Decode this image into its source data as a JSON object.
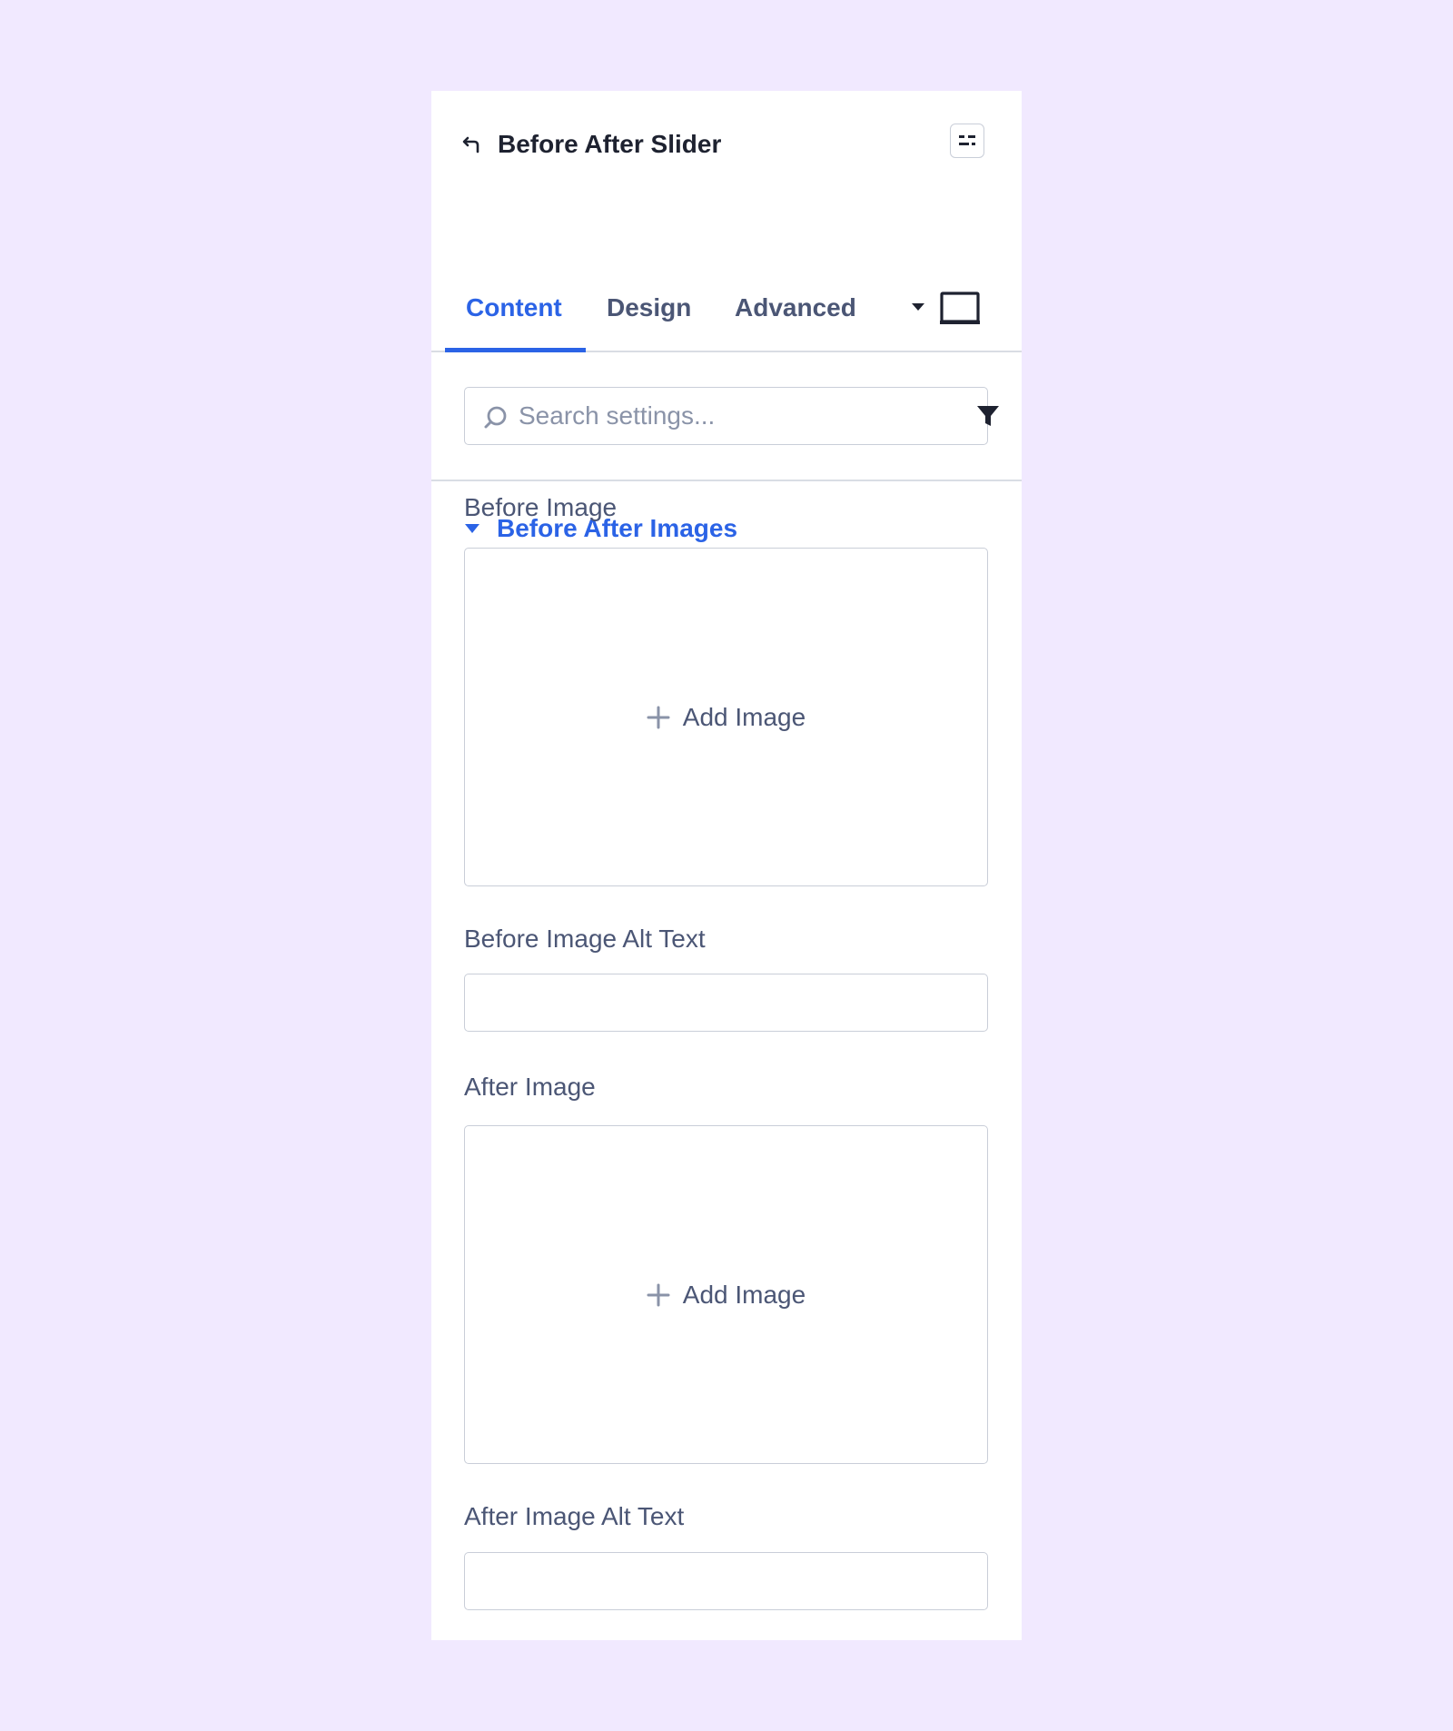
{
  "header": {
    "title": "Before After Slider",
    "back_icon": "back-arrow-icon",
    "layout_icon": "layout-toggle-icon"
  },
  "tabs": [
    {
      "label": "Content",
      "active": true
    },
    {
      "label": "Design",
      "active": false
    },
    {
      "label": "Advanced",
      "active": false
    }
  ],
  "search": {
    "placeholder": "Search settings...",
    "value": ""
  },
  "section": {
    "title": "Before After Images",
    "expanded": true,
    "fields": {
      "before_image_label": "Before Image",
      "before_image_button": "Add Image",
      "before_alt_label": "Before Image Alt Text",
      "before_alt_value": "",
      "after_image_label": "After Image",
      "after_image_button": "Add Image",
      "after_alt_label": "After Image Alt Text",
      "after_alt_value": ""
    }
  },
  "colors": {
    "background": "#f1e9ff",
    "panel": "#ffffff",
    "accent": "#2b63e6",
    "text": "#4b5675",
    "title": "#1e2230",
    "border": "#c9ced8"
  }
}
